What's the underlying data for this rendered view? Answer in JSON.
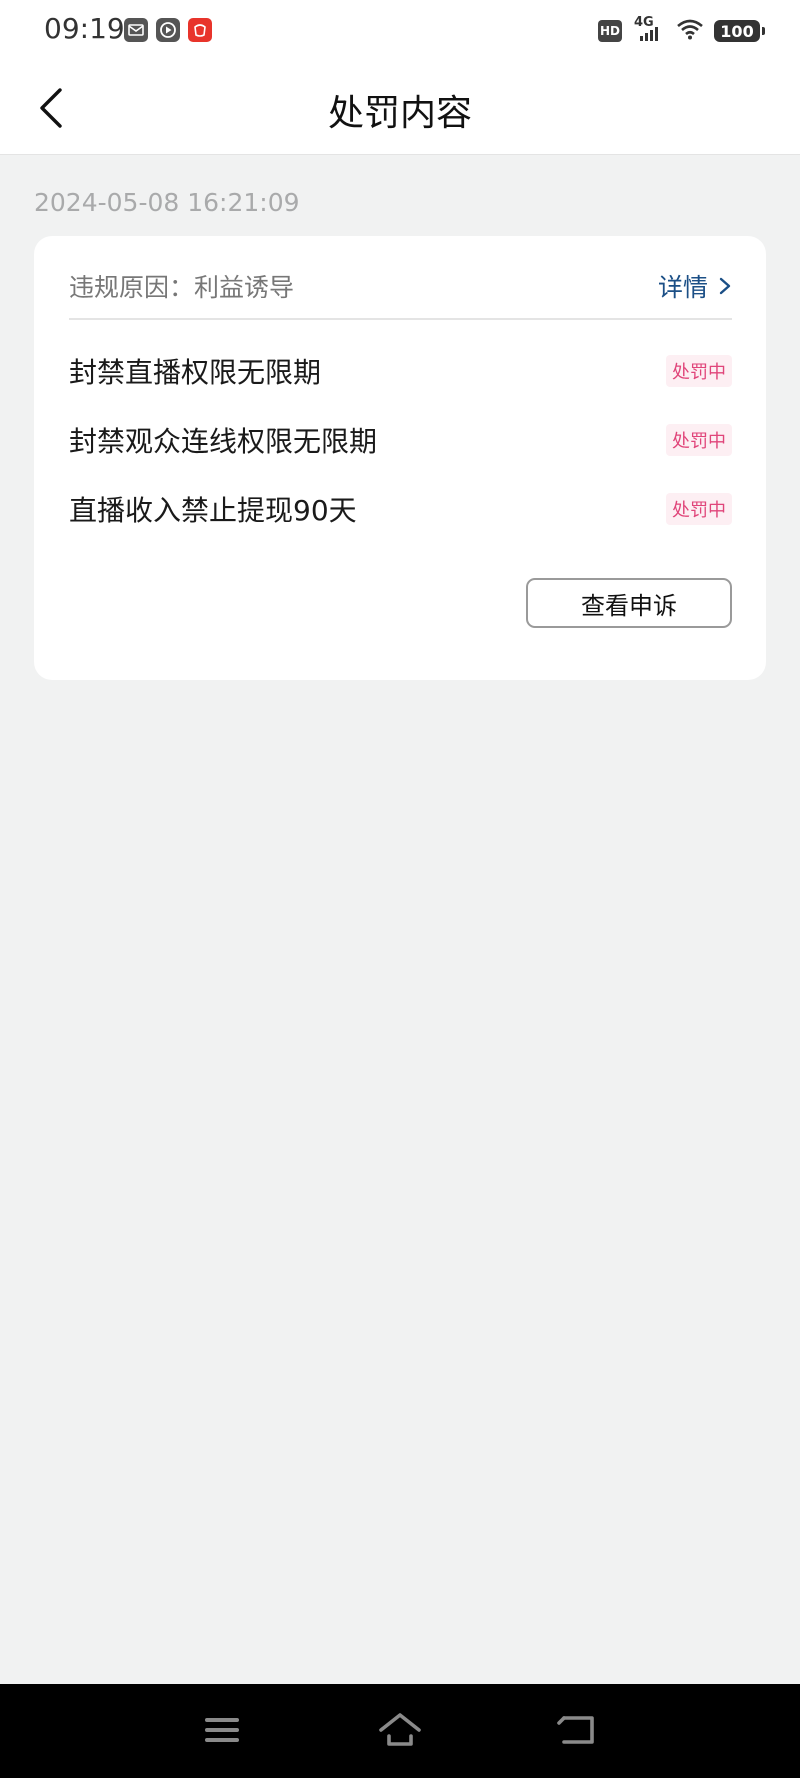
{
  "status_bar": {
    "time": "09:19",
    "notification_icons": [
      "mail-icon",
      "play-icon",
      "taobao-icon"
    ],
    "hd_label": "HD",
    "network_label": "4G",
    "battery": "100"
  },
  "header": {
    "title": "处罚内容",
    "back_icon": "chevron-left-icon"
  },
  "record": {
    "timestamp": "2024-05-08 16:21:09",
    "reason": "违规原因：利益诱导",
    "detail_label": "详情",
    "penalties": [
      {
        "text": "封禁直播权限无限期",
        "status": "处罚中"
      },
      {
        "text": "封禁观众连线权限无限期",
        "status": "处罚中"
      },
      {
        "text": "直播收入禁止提现90天",
        "status": "处罚中"
      }
    ],
    "appeal_label": "查看申诉"
  },
  "system_nav": {
    "buttons": [
      "menu-icon",
      "home-icon",
      "back-icon"
    ]
  },
  "colors": {
    "background": "#f1f2f2",
    "card": "#ffffff",
    "link": "#1b4f86",
    "badge_text": "#e0457a",
    "badge_bg": "#fdeff3"
  }
}
